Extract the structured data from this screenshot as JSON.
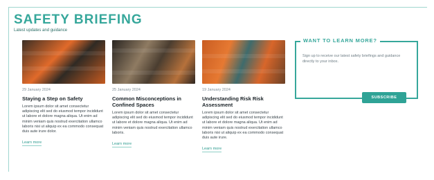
{
  "title": "Safety Briefing",
  "subtitle": "Latest updates and guidance",
  "posts": [
    {
      "date": "29 January 2024",
      "headline": "Staying a Step on Safety",
      "excerpt": "Lorem ipsum dolor sit amet consectetur adipiscing elit sed do eiusmod tempor incididunt ut labore et dolore magna aliqua. Ut enim ad minim veniam quis nostrud exercitation ullamco laboris nisi ut aliquip ex ea commodo consequat duis aute irure dolor.",
      "more": "Learn more"
    },
    {
      "date": "25 January 2024",
      "headline": "Common Misconceptions in Confined Spaces",
      "excerpt": "Lorem ipsum dolor sit amet consectetur adipiscing elit sed do eiusmod tempor incididunt ut labore et dolore magna aliqua. Ut enim ad minim veniam quis nostrud exercitation ullamco laboris.",
      "more": "Learn more"
    },
    {
      "date": "19 January 2024",
      "headline": "Understanding Risk Risk Assessment",
      "excerpt": "Lorem ipsum dolor sit amet consectetur adipiscing elit sed do eiusmod tempor incididunt ut labore et dolore magna aliqua. Ut enim ad minim veniam quis nostrud exercitation ullamco laboris nisi ut aliquip ex ea commodo consequat duis aute irure.",
      "more": "Learn more"
    }
  ],
  "signup": {
    "title": "Want to learn more?",
    "text": "Sign up to receive our latest safety briefings and guidance directly to your inbox.",
    "button": "Subscribe"
  }
}
